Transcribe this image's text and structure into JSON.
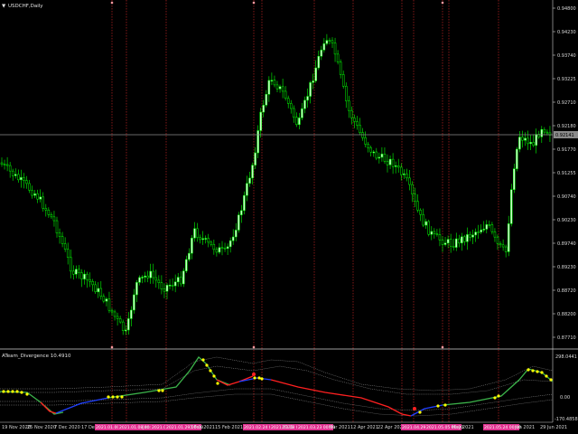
{
  "window": {
    "symbol_title": "USDCHF,Daily"
  },
  "indicator": {
    "title": "ATeam_Divergence 10.4910",
    "scale_labels": [
      "298.0441",
      "0.00",
      "-170.4858"
    ]
  },
  "price_axis": {
    "labels": [
      "0.94800",
      "0.94230",
      "0.93740",
      "0.93225",
      "0.92710",
      "0.92180",
      "0.91770",
      "0.91255",
      "0.90740",
      "0.90230",
      "0.89740",
      "0.89230",
      "0.88720",
      "0.88200",
      "0.87710"
    ],
    "current_price": "0.92141"
  },
  "time_axis": {
    "labels": [
      {
        "text": "19 Nov 2020",
        "tag": false
      },
      {
        "text": "25 Nov 2020",
        "tag": false
      },
      {
        "text": "7 Dec 2020",
        "tag": false
      },
      {
        "text": "17 Dec",
        "tag": false
      },
      {
        "text": "2021.01.00 00:00",
        "tag": true
      },
      {
        "text": "2021.01.08 00:00",
        "tag": true
      },
      {
        "text": "Jan",
        "tag": false
      },
      {
        "text": "2021.01.26 00:00",
        "tag": true
      },
      {
        "text": "2021.01.29 00:00",
        "tag": true
      },
      {
        "text": "3 Feb 2021",
        "tag": false
      },
      {
        "text": "15 Feb 2021",
        "tag": false
      },
      {
        "text": "2021.02.24 00:00",
        "tag": true
      },
      {
        "text": "2021.03.08 00:00",
        "tag": true
      },
      {
        "text": "2021",
        "tag": false
      },
      {
        "text": "2021.03.23 00:00",
        "tag": true
      },
      {
        "text": "Mar 2021",
        "tag": false
      },
      {
        "text": "12 Apr 2021",
        "tag": false
      },
      {
        "text": "22 Apr 2021",
        "tag": false
      },
      {
        "text": "2021.04.29 00:00",
        "tag": true
      },
      {
        "text": "2021.05.05 00:00",
        "tag": true
      },
      {
        "text": "May 2021",
        "tag": false
      },
      {
        "text": "2021.05.24 00:00",
        "tag": true
      },
      {
        "text": "Jun 2021",
        "tag": false
      },
      {
        "text": "29 Jun 2021",
        "tag": false
      }
    ]
  },
  "colors": {
    "background": "#000000",
    "candle": "#00ff00",
    "candle_bull_body": "#ccffcc",
    "grid_vline": "#ff3333",
    "tag_bg": "#e0308f",
    "price_line": "#8a8a8a",
    "osc_green": "#3cb44b",
    "osc_red": "#ff2020",
    "osc_blue": "#2040ff",
    "osc_yellow": "#ffff00",
    "band": "#9a9a9a"
  }
}
